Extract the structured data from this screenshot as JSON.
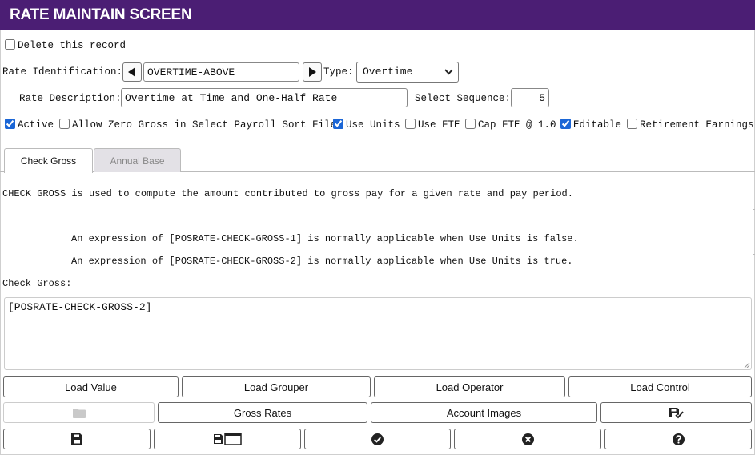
{
  "title": "RATE MAINTAIN SCREEN",
  "delete_label": "Delete this record",
  "rate_id": {
    "label": "Rate Identification:",
    "value": "OVERTIME-ABOVE"
  },
  "type": {
    "label": "Type:",
    "value": "Overtime"
  },
  "rate_desc": {
    "label": "Rate Description:",
    "value": "Overtime at Time and One-Half Rate"
  },
  "select_seq": {
    "label": "Select Sequence:",
    "value": "5"
  },
  "checkboxes": {
    "active": {
      "label": "Active",
      "checked": true
    },
    "allow_zero": {
      "label": "Allow Zero Gross in Select Payroll Sort File",
      "checked": false
    },
    "use_units": {
      "label": "Use Units",
      "checked": true
    },
    "use_fte": {
      "label": "Use FTE",
      "checked": false
    },
    "cap_fte": {
      "label": "Cap FTE @ 1.0",
      "checked": false
    },
    "editable": {
      "label": "Editable",
      "checked": true
    },
    "retirement": {
      "label": "Retirement Earnings",
      "checked": false
    }
  },
  "tabs": {
    "check_gross": "Check Gross",
    "annual_base": "Annual Base"
  },
  "info": {
    "line1": "CHECK GROSS is used to compute the amount contributed to gross pay for a given rate and pay period.",
    "line2": "An expression of [POSRATE-CHECK-GROSS-1] is normally applicable when Use Units is false.",
    "line3": "An expression of [POSRATE-CHECK-GROSS-2] is normally applicable when Use Units is true."
  },
  "check_gross": {
    "label": "Check Gross:",
    "value": "[POSRATE-CHECK-GROSS-2]"
  },
  "buttons": {
    "load_value": "Load Value",
    "load_grouper": "Load Grouper",
    "load_operator": "Load Operator",
    "load_control": "Load Control",
    "gross_rates": "Gross Rates",
    "account_images": "Account Images"
  },
  "icons": {
    "folder": "folder-icon",
    "save_check": "save-check-icon",
    "save": "save-icon",
    "save_window": "save-window-icon",
    "ok": "check-circle-icon",
    "cancel": "x-circle-icon",
    "help": "question-circle-icon"
  },
  "colors": {
    "header_bg": "#4b1e74",
    "checkbox_accent": "#1b66d6"
  }
}
